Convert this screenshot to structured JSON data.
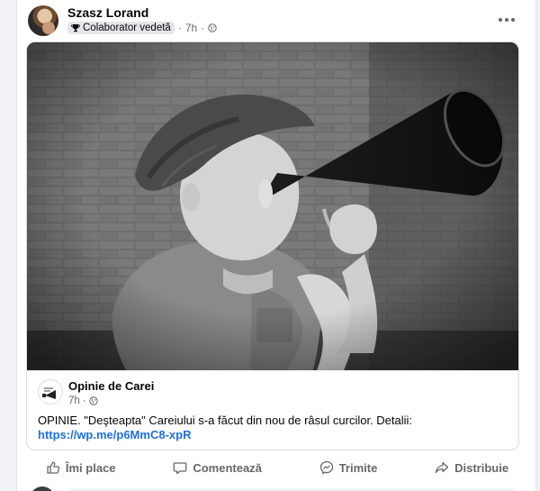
{
  "post": {
    "author": "Szasz Lorand",
    "badge": "Colaborator vedetă",
    "time": "7h"
  },
  "shared": {
    "page_name": "Opinie de Carei",
    "page_time": "7h",
    "text": "OPINIE. \"Deşteapta\" Careiului s-a făcut din nou de râsul curcilor. Detalii:",
    "link": "https://wp.me/p6MmC8-xpR",
    "logo_text": "opinie de Carei"
  },
  "actions": {
    "like": "Îmi place",
    "comment": "Comentează",
    "send": "Trimite",
    "share": "Distribuie"
  },
  "colors": {
    "link": "#216fdb",
    "secondary": "#65676b"
  },
  "icons": [
    "trophy-icon",
    "globe-icon",
    "more-options-icon",
    "like-icon",
    "comment-icon",
    "messenger-icon",
    "share-icon"
  ]
}
